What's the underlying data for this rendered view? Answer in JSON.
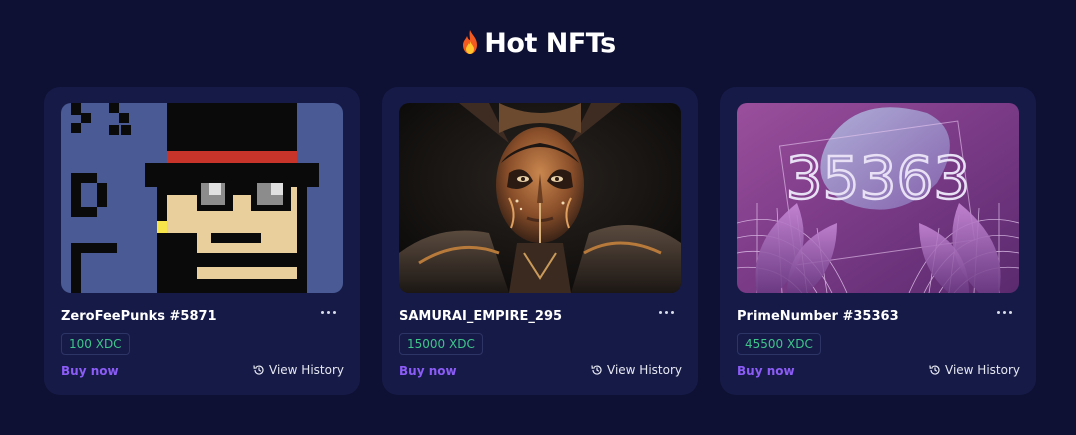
{
  "header": {
    "title": "Hot NFTs",
    "icon": "fire-icon"
  },
  "cards": [
    {
      "name": "ZeroFeePunks #5871",
      "price": "100 XDC",
      "buy_label": "Buy now",
      "history_label": "View History"
    },
    {
      "name": "SAMURAI_EMPIRE_295",
      "price": "15000 XDC",
      "buy_label": "Buy now",
      "history_label": "View History"
    },
    {
      "name": "PrimeNumber #35363",
      "price": "45500 XDC",
      "buy_label": "Buy now",
      "history_label": "View History"
    }
  ],
  "art_text": {
    "prime_number": "35363"
  },
  "colors": {
    "background": "#0e1133",
    "card": "#161a47",
    "price_text": "#3ec58a",
    "buy_now": "#8b5cf6"
  }
}
